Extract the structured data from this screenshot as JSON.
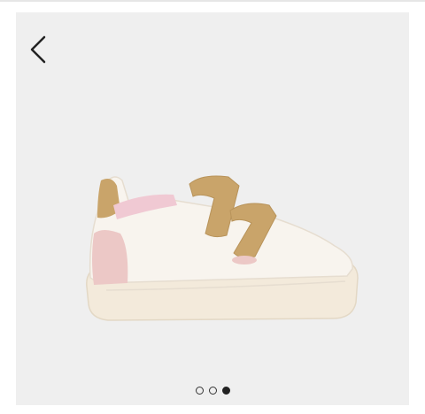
{
  "gallery": {
    "back_icon": "chevron-left-icon",
    "image_description": "",
    "dots_count": 3,
    "active_index": 2
  },
  "colors": {
    "background": "#efefef",
    "shoe_body": "#f6f1ea",
    "glitter": "#c9a46a",
    "pink": "#e9c4c4",
    "dot_active": "#222222"
  }
}
